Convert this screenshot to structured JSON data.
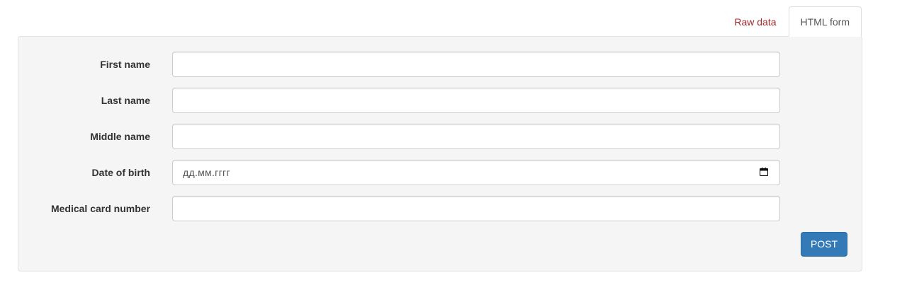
{
  "tabs": {
    "raw_data": "Raw data",
    "html_form": "HTML form"
  },
  "form": {
    "fields": [
      {
        "label": "First name",
        "value": ""
      },
      {
        "label": "Last name",
        "value": ""
      },
      {
        "label": "Middle name",
        "value": ""
      },
      {
        "label": "Date of birth",
        "placeholder": "дд.мм.гггг"
      },
      {
        "label": "Medical card number",
        "value": ""
      }
    ],
    "submit_label": "POST"
  },
  "colors": {
    "link": "#a12a2a",
    "primary_button": "#337ab7",
    "panel_background": "#f5f5f5"
  },
  "icons": {
    "date_picker": "calendar-icon"
  }
}
